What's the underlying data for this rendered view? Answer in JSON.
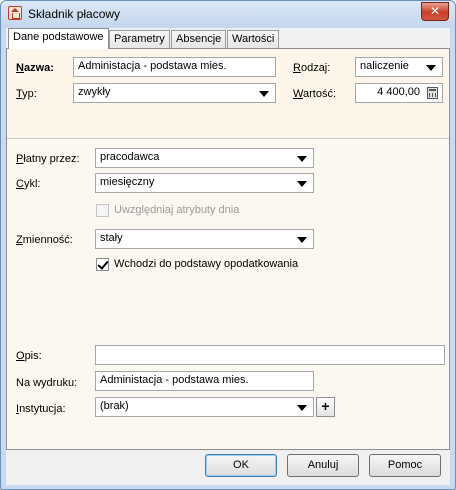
{
  "window": {
    "title": "Składnik płacowy",
    "close_glyph": "✕"
  },
  "tabs": [
    {
      "label": "Dane podstawowe",
      "active": true
    },
    {
      "label": "Parametry",
      "active": false
    },
    {
      "label": "Absencje",
      "active": false
    },
    {
      "label": "Wartości",
      "active": false
    }
  ],
  "form": {
    "nazwa": {
      "label": "Nazwa:",
      "value": "Administacja - podstawa mies."
    },
    "typ": {
      "label": "Typ:",
      "value": "zwykły"
    },
    "rodzaj": {
      "label": "Rodzaj:",
      "value": "naliczenie"
    },
    "wartosc": {
      "label": "Wartość:",
      "value": "4 400,00"
    },
    "platny_przez": {
      "label": "Płatny przez:",
      "value": "pracodawca"
    },
    "cykl": {
      "label": "Cykl:",
      "value": "miesięczny"
    },
    "uwzgledniaj": {
      "label": "Uwzględniaj atrybuty dnia",
      "checked": false,
      "enabled": false
    },
    "zmiennosc": {
      "label": "Zmienność:",
      "value": "stały"
    },
    "wchodzi": {
      "label": "Wchodzi do podstawy opodatkowania",
      "checked": true
    },
    "opis": {
      "label": "Opis:",
      "value": ""
    },
    "na_wydruku": {
      "label": "Na wydruku:",
      "value": "Administacja - podstawa mies."
    },
    "instytucja": {
      "label": "Instytucja:",
      "value": "(brak)"
    },
    "add_glyph": "+"
  },
  "buttons": {
    "ok": "OK",
    "cancel": "Anuluj",
    "help": "Pomoc"
  },
  "icons": {
    "app": "app-icon",
    "calculator": "calculator-icon",
    "dropdown": "chevron-down-icon",
    "close": "close-icon"
  }
}
